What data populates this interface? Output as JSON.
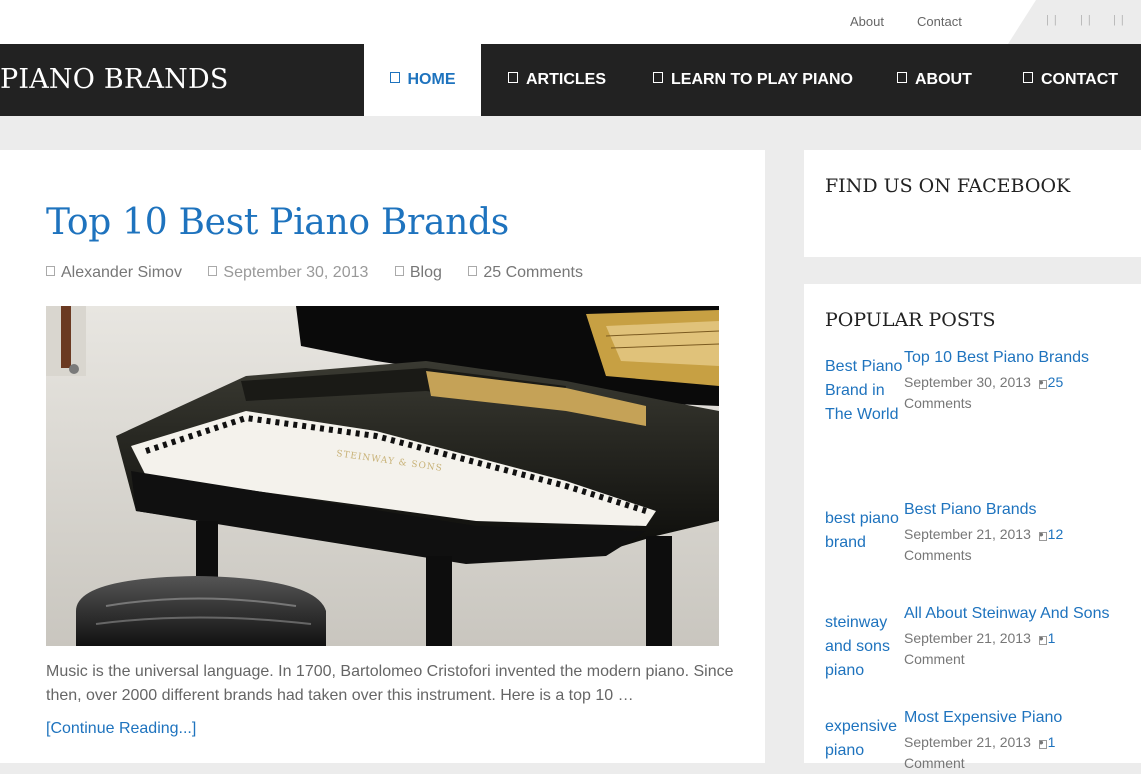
{
  "topbar": {
    "links": [
      "About",
      "Contact"
    ],
    "social_icons": [
      "facebook-icon",
      "twitter-icon",
      "google-plus-icon"
    ],
    "social_glyphs": [
      "| |",
      "| |",
      "| |"
    ]
  },
  "site": {
    "title": "PIANO BRANDS"
  },
  "nav": {
    "items": [
      "HOME",
      "ARTICLES",
      "LEARN TO PLAY PIANO",
      "ABOUT",
      "CONTACT"
    ],
    "active": "HOME"
  },
  "post": {
    "title": "Top 10 Best Piano Brands",
    "author": "Alexander Simov",
    "date": "September 30, 2013",
    "category": "Blog",
    "comments": "25 Comments",
    "excerpt": "Music is the universal language. In 1700, Bartolomeo Cristofori invented the modern piano. Since then, over 2000 different brands had taken over this instrument. Here is a top 10 …",
    "read_more": "[Continue Reading...]",
    "image_brand": "STEINWAY & SONS"
  },
  "sidebar": {
    "facebook_title": "FIND US ON FACEBOOK",
    "popular_title": "POPULAR POSTS",
    "popular_posts": [
      {
        "thumb_alt": "Best Piano Brand in The World",
        "title": "Top 10 Best Piano Brands",
        "date": "September 30, 2013",
        "count": "25",
        "unit": "Comments"
      },
      {
        "thumb_alt": "best piano brand",
        "title": "Best Piano Brands",
        "date": "September 21, 2013",
        "count": "12",
        "unit": "Comments"
      },
      {
        "thumb_alt": "steinway and sons piano",
        "title": "All About Steinway And Sons",
        "date": "September 21, 2013",
        "count": "1",
        "unit": "Comment"
      },
      {
        "thumb_alt": "expensive piano",
        "title": "Most Expensive Piano",
        "date": "September 21, 2013",
        "count": "1",
        "unit": "Comment"
      }
    ]
  },
  "colors": {
    "accent": "#1e73be",
    "nav_bg": "#222222",
    "page_bg": "#ececec"
  }
}
